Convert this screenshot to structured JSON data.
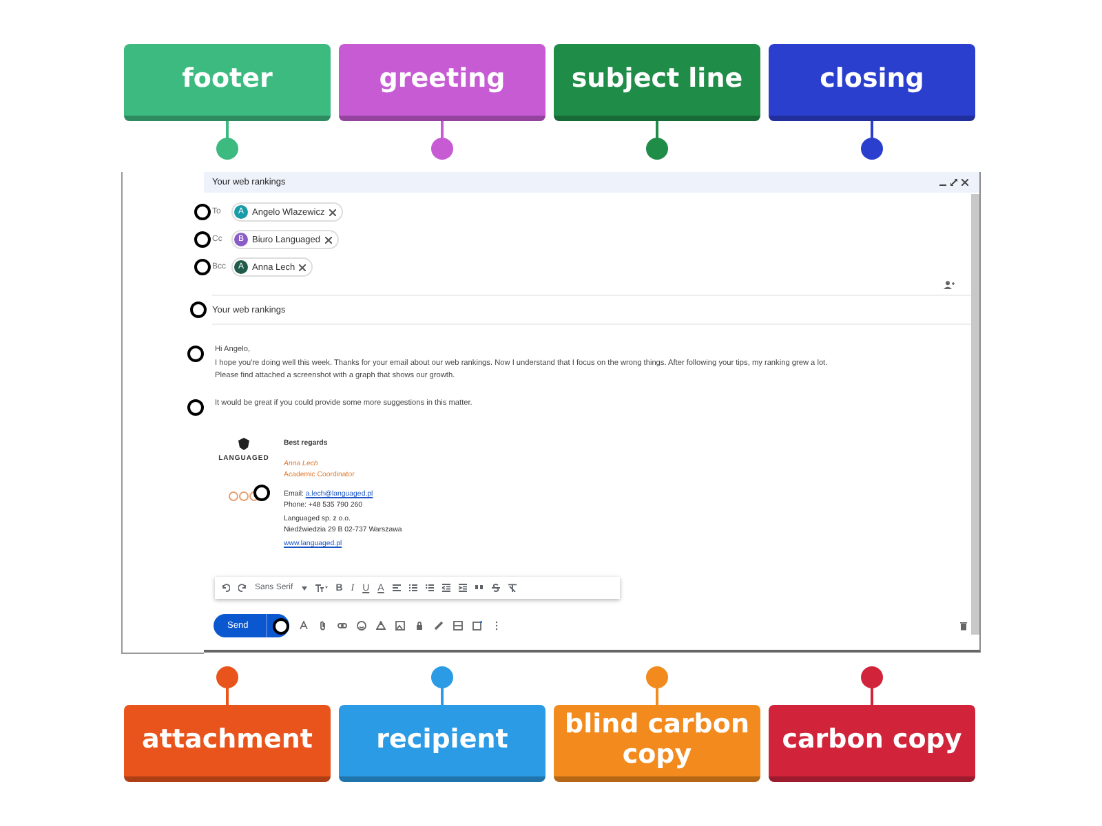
{
  "labels_top": [
    {
      "text": "footer",
      "color": "#3cba7f"
    },
    {
      "text": "greeting",
      "color": "#c65bd4"
    },
    {
      "text": "subject line",
      "color": "#1f8c48"
    },
    {
      "text": "closing",
      "color": "#2b3fcf"
    }
  ],
  "compose": {
    "title": "Your web rankings",
    "recipients": [
      {
        "field": "To",
        "initial": "A",
        "name": "Angelo Wlazewicz",
        "color": "#1a9ba8",
        "marker": true
      },
      {
        "field": "Cc",
        "initial": "B",
        "name": "Biuro Languaged",
        "color": "#8a5cc7",
        "marker": true
      },
      {
        "field": "Bcc",
        "initial": "A",
        "name": "Anna Lech",
        "color": "#1e5b4a",
        "marker": true
      }
    ],
    "subject": {
      "text": "Your web rankings",
      "marker": true
    },
    "body": [
      {
        "lines": [
          {
            "text": "Hi Angelo,",
            "marker": true
          },
          {
            "text": "I hope you're doing well this week. Thanks for your email about our web rankings. Now I understand that I focus on the wrong things. After following your tips, my ranking grew a lot.",
            "marker": false
          },
          {
            "text": "Please find attached a screenshot with a graph that shows our growth.",
            "marker": false
          }
        ]
      },
      {
        "lines": [
          {
            "text": "It would be great if you could provide some more suggestions in this matter.",
            "marker": true
          }
        ]
      }
    ],
    "signature": {
      "logo_text": "LANGUAGED",
      "marker": true,
      "closing": "Best regards",
      "name": "Anna Lech",
      "role": "Academic Coordinator",
      "email_label": "Email:",
      "email": "a.lech@languaged.pl",
      "phone": "Phone: +48 535 790 260",
      "company": "Languaged sp. z o.o.",
      "address": "Niedźwiedzia 29 B 02-737 Warszawa",
      "website": "www.languaged.pl"
    },
    "format_toolbar": {
      "font": "Sans Serif",
      "letters": [
        "B",
        "I",
        "U",
        "A"
      ]
    },
    "send_bar": {
      "send": "Send",
      "marker": true
    }
  },
  "labels_bottom": [
    {
      "text": "attachment",
      "color": "#e8541c"
    },
    {
      "text": "recipient",
      "color": "#2b9be6"
    },
    {
      "text": "blind carbon copy",
      "color": "#f28a1d"
    },
    {
      "text": "carbon copy",
      "color": "#d1243b"
    }
  ]
}
